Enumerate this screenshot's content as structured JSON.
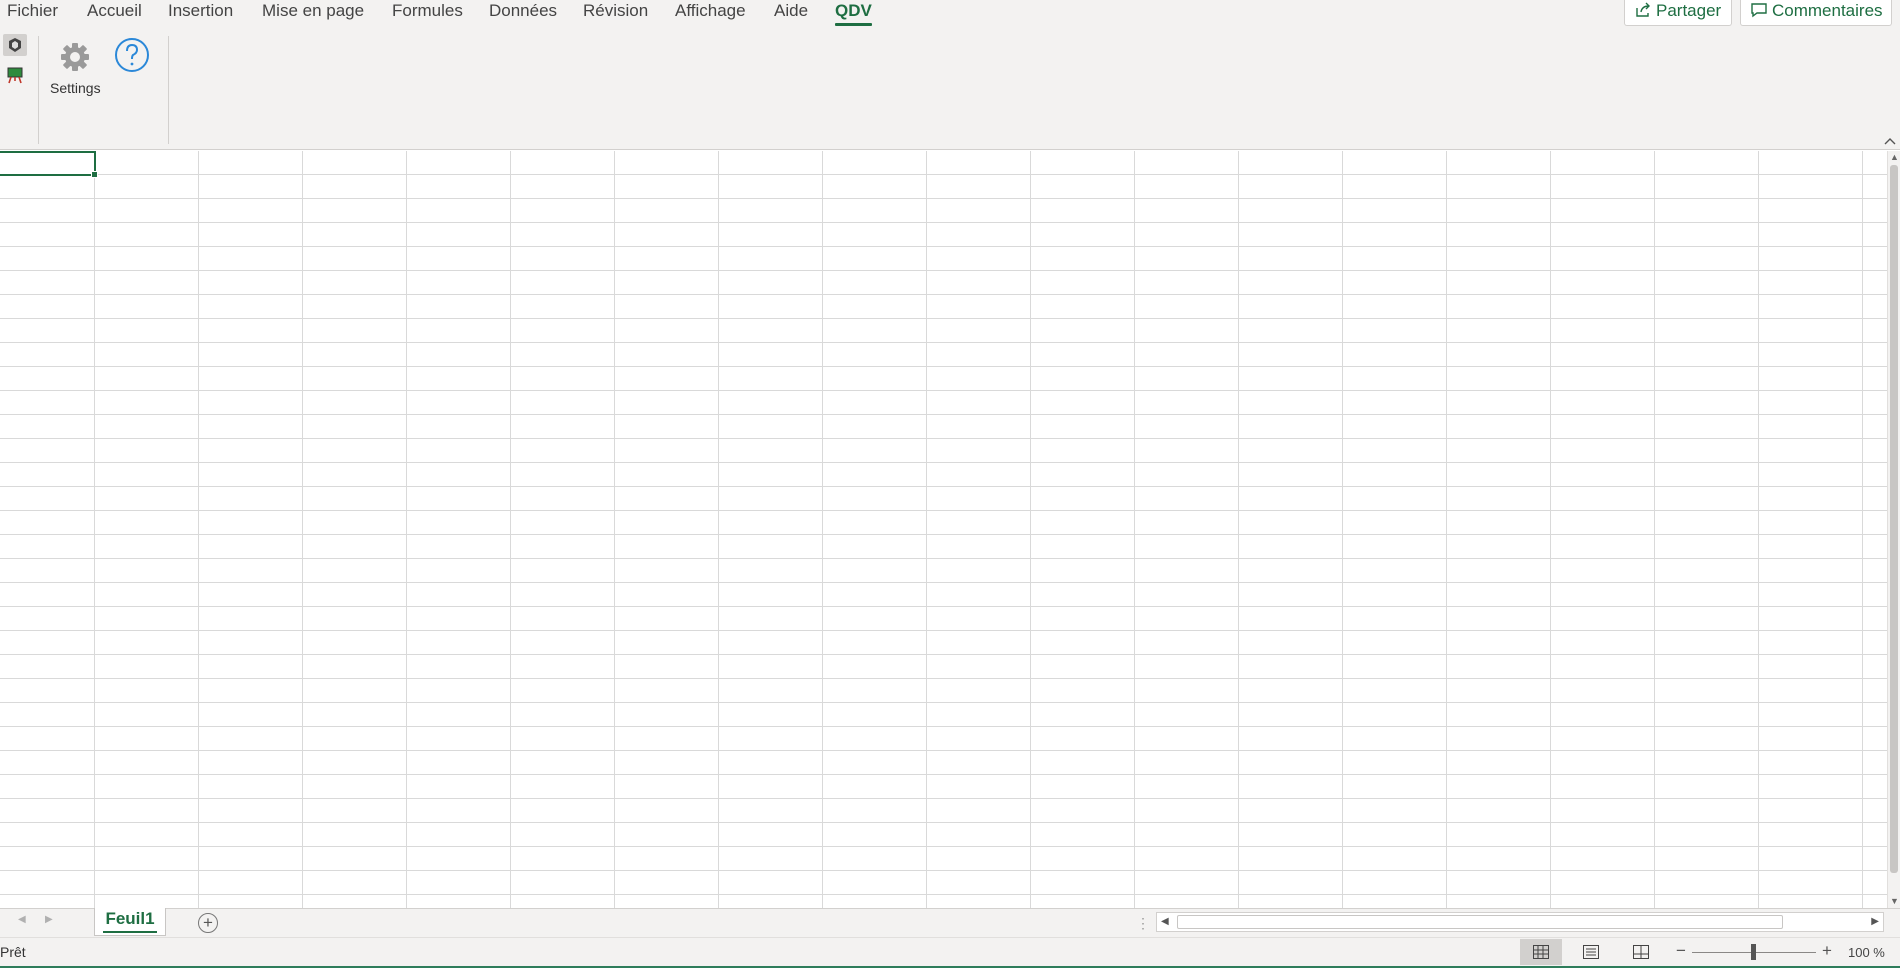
{
  "menu": {
    "tabs": [
      "Fichier",
      "Accueil",
      "Insertion",
      "Mise en page",
      "Formules",
      "Données",
      "Révision",
      "Affichage",
      "Aide",
      "QDV"
    ],
    "active_tab": "QDV",
    "share_label": "Partager",
    "comments_label": "Commentaires"
  },
  "ribbon": {
    "settings_label": "Settings",
    "icons": [
      "cube-icon",
      "easel-icon",
      "gear-icon",
      "help-icon"
    ]
  },
  "sheets": {
    "tabs": [
      "Feuil1"
    ],
    "active": "Feuil1"
  },
  "status": {
    "ready_text": "Prêt",
    "zoom": "100 %",
    "view_modes": [
      "normal",
      "page-layout",
      "page-break-preview"
    ],
    "active_view": "normal"
  },
  "colors": {
    "accent": "#1e6e42",
    "ribbon_bg": "#f3f2f1",
    "gridline": "#d9d9d9"
  }
}
